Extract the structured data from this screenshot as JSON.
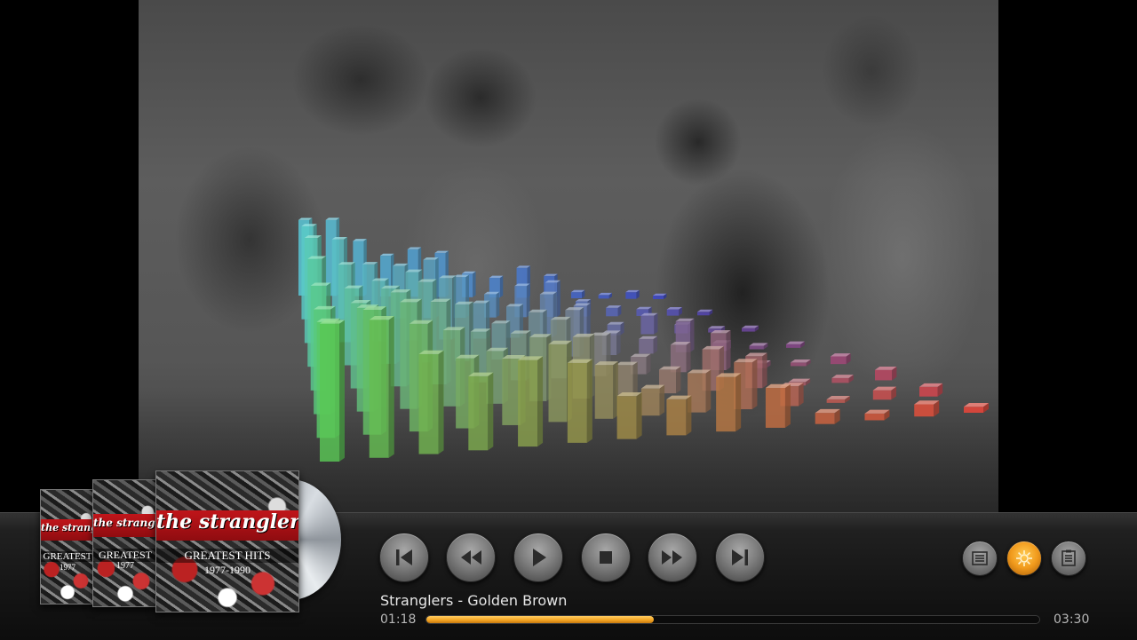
{
  "now_playing": {
    "title": "Stranglers - Golden Brown",
    "elapsed": "01:18",
    "total": "03:30",
    "progress": 0.3714
  },
  "album_covers": [
    {
      "band": "the stranglers",
      "title": "GREATEST",
      "years": "1977"
    },
    {
      "band": "the stranglers",
      "title": "GREATEST",
      "years": "1977"
    },
    {
      "band": "the stranglers",
      "title": "GREATEST   HITS",
      "years": "1977-1990"
    }
  ],
  "transport": [
    {
      "name": "skip-previous",
      "icon": "skip-previous-icon"
    },
    {
      "name": "rewind",
      "icon": "rewind-icon"
    },
    {
      "name": "play",
      "icon": "play-icon"
    },
    {
      "name": "stop",
      "icon": "stop-icon"
    },
    {
      "name": "fast-forward",
      "icon": "fast-forward-icon"
    },
    {
      "name": "skip-next",
      "icon": "skip-next-icon"
    }
  ],
  "side_buttons": [
    {
      "name": "playlist",
      "icon": "playlist-icon",
      "active": false
    },
    {
      "name": "visualization",
      "icon": "visualization-icon",
      "active": true
    },
    {
      "name": "notes",
      "icon": "notes-icon",
      "active": false
    }
  ],
  "colors": {
    "accent": "#f5a623",
    "visualizer_front": "#5fd35a",
    "visualizer_back_left": "#5fd6e6",
    "visualizer_back_right": "#3f4bd8",
    "visualizer_front_right": "#ff4a3c"
  }
}
